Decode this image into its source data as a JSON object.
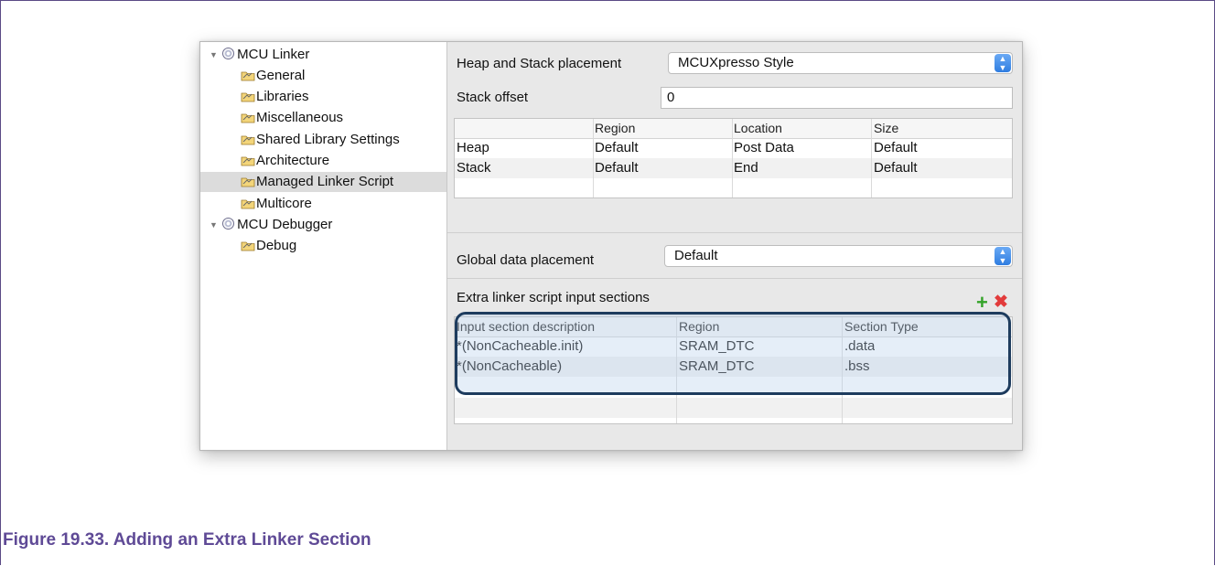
{
  "tree": {
    "items": [
      {
        "label": "MCU Linker",
        "level": 0,
        "expanded": true,
        "icon": "gear-icon"
      },
      {
        "label": "General",
        "level": 1,
        "icon": "folder-icon"
      },
      {
        "label": "Libraries",
        "level": 1,
        "icon": "folder-icon"
      },
      {
        "label": "Miscellaneous",
        "level": 1,
        "icon": "folder-icon"
      },
      {
        "label": "Shared Library Settings",
        "level": 1,
        "icon": "folder-icon"
      },
      {
        "label": "Architecture",
        "level": 1,
        "icon": "folder-icon"
      },
      {
        "label": "Managed Linker Script",
        "level": 1,
        "icon": "folder-icon",
        "selected": true
      },
      {
        "label": "Multicore",
        "level": 1,
        "icon": "folder-icon"
      },
      {
        "label": "MCU Debugger",
        "level": 0,
        "expanded": true,
        "icon": "gear-icon"
      },
      {
        "label": "Debug",
        "level": 1,
        "icon": "folder-icon"
      }
    ]
  },
  "heap_stack": {
    "placement_label": "Heap and Stack placement",
    "placement_value": "MCUXpresso Style",
    "offset_label": "Stack offset",
    "offset_value": "0",
    "columns": [
      "",
      "Region",
      "Location",
      "Size"
    ],
    "rows": [
      [
        "Heap",
        "Default",
        "Post Data",
        "Default"
      ],
      [
        "Stack",
        "Default",
        "End",
        "Default"
      ]
    ]
  },
  "global": {
    "label": "Global data placement",
    "value": "Default"
  },
  "extra": {
    "label": "Extra linker script input sections",
    "add_icon": "plus-icon",
    "remove_icon": "delete-icon",
    "columns": [
      "Input section description",
      "Region",
      "Section Type"
    ],
    "rows": [
      [
        "*(NonCacheable.init)",
        "SRAM_DTC",
        ".data"
      ],
      [
        "*(NonCacheable)",
        "SRAM_DTC",
        ".bss"
      ]
    ]
  },
  "colors": {
    "caption": "#5f4a96",
    "highlight_border": "#1e3c5e",
    "combo_arrow": "#2f7de0"
  },
  "caption": "Figure 19.33. Adding an Extra Linker Section"
}
